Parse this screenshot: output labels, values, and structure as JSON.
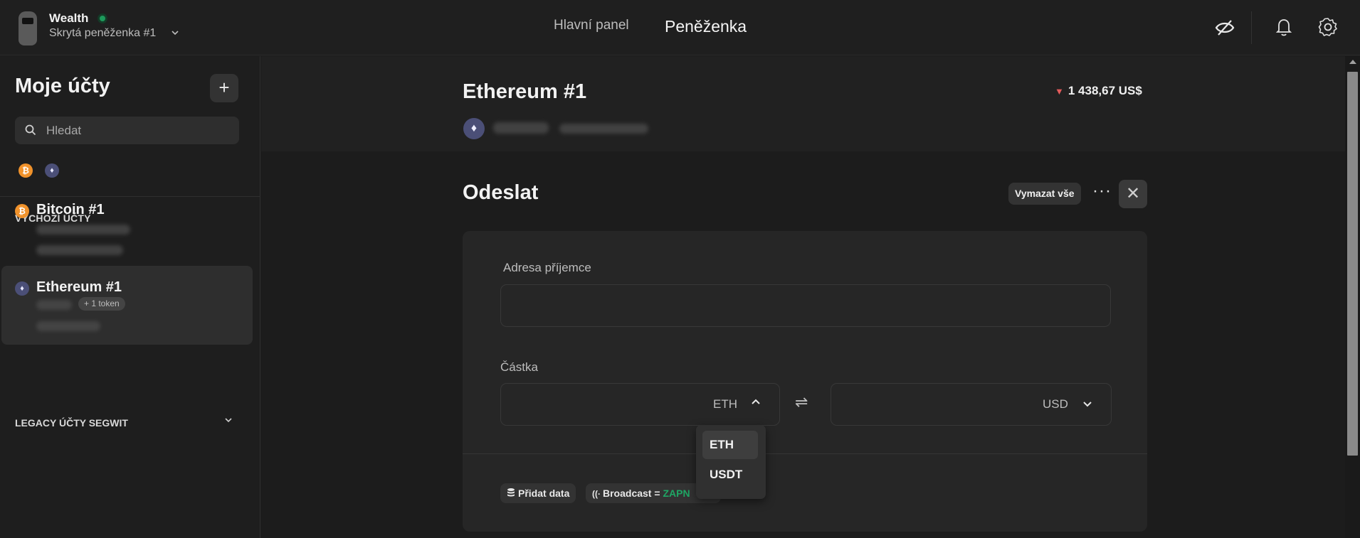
{
  "app": {
    "wallet_name": "Wealth",
    "wallet_sub": "Skrytá peněženka #1",
    "nav": {
      "dashboard": "Hlavní panel",
      "wallet": "Peněženka"
    }
  },
  "sidebar": {
    "title": "Moje účty",
    "add_label": "+",
    "search": {
      "placeholder": "Hledat",
      "value": ""
    },
    "filters": [
      "bitcoin",
      "ethereum"
    ],
    "section_default": "VÝCHOZÍ ÚČTY",
    "accounts": [
      {
        "name": "Bitcoin #1",
        "coin": "₿"
      },
      {
        "name": "Ethereum #1",
        "coin": "♦",
        "token_badge": "+ 1 token"
      }
    ],
    "section_legacy": "LEGACY ÚČTY SEGWIT"
  },
  "account": {
    "title": "Ethereum #1",
    "price_change": "1 438,67 US$",
    "price_direction": "down"
  },
  "send": {
    "title": "Odeslat",
    "clear_all": "Vymazat vše",
    "more": "···",
    "close": "✕",
    "recipient_label": "Adresa příjemce",
    "recipient_value": "",
    "amount_label": "Částka",
    "amount_value": "",
    "amount_unit": "ETH",
    "fiat_value": "",
    "fiat_unit": "USD",
    "swap_icon": "⇌",
    "add_data": "Přidat data",
    "broadcast_label": "Broadcast =",
    "broadcast_state": "ZAPN",
    "unit_options": [
      "ETH",
      "USDT"
    ]
  },
  "colors": {
    "accent_green": "#1fa664",
    "down_red": "#e35b5b",
    "btc": "#f0922b",
    "eth": "#4b4f77"
  }
}
